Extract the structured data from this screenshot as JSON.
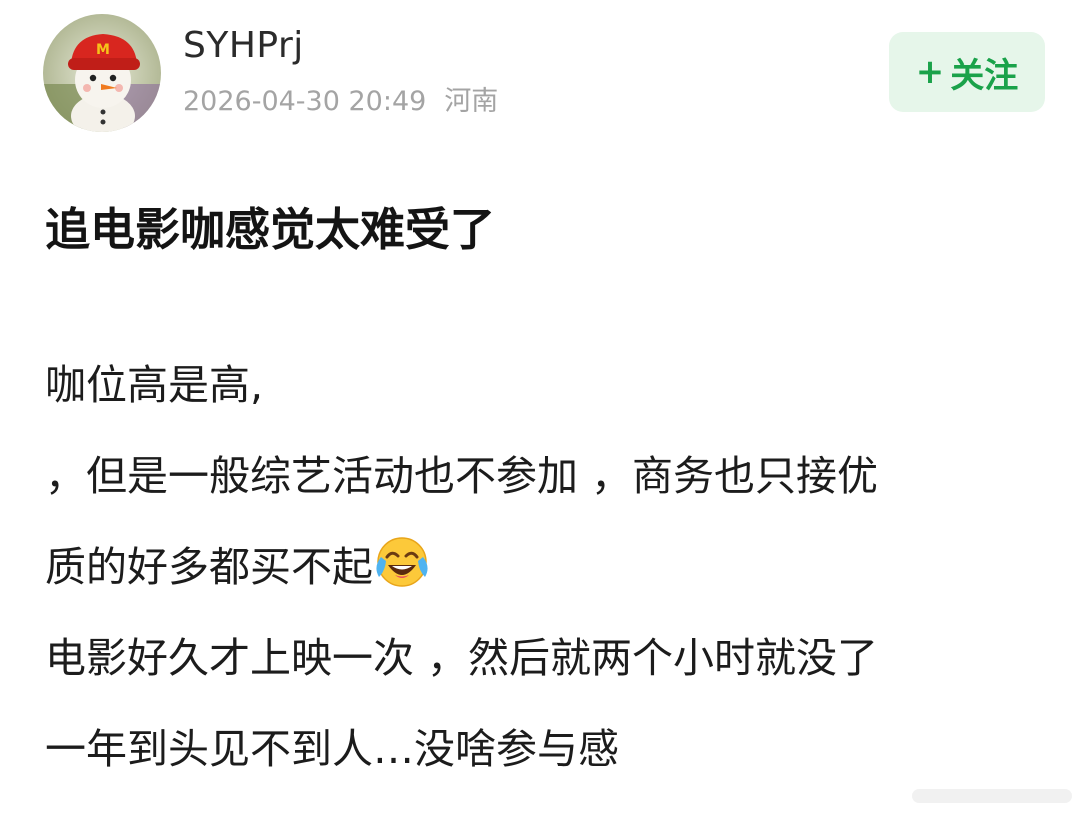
{
  "author": {
    "username": "SYHPrj",
    "timestamp": "2026-04-30 20:49",
    "location": "河南",
    "avatar_icon": "snowman-with-red-cap-avatar"
  },
  "follow": {
    "plus": "+",
    "label": "关注",
    "accent_color": "#1aa24a",
    "background_color": "#e6f6ea"
  },
  "post": {
    "title": "追电影咖感觉太难受了",
    "lines": [
      "咖位高是高,",
      "，但是一般综艺活动也不参加 ，商务也只接优",
      "质的好多都买不起",
      "电影好久才上映一次 ，然后就两个小时就没了",
      "一年到头见不到人…没啥参与感"
    ],
    "emoji_icon": "face-with-tears-of-joy-icon"
  }
}
